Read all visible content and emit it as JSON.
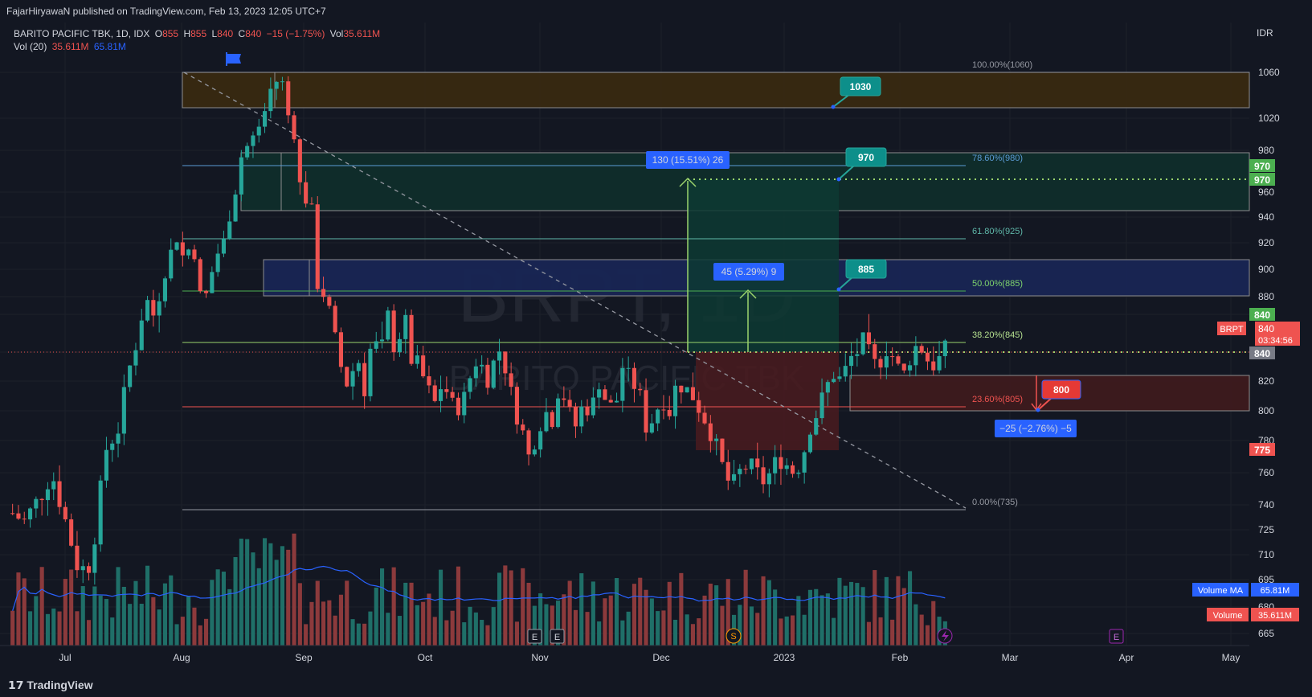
{
  "header": {
    "published": "FajarHiryawaN published on TradingView.com, Feb 13, 2023 12:05 UTC+7"
  },
  "legend": {
    "symbol": "BARITO PACIFIC TBK, 1D, IDX",
    "o_label": "O",
    "o_val": "855",
    "h_label": "H",
    "h_val": "855",
    "l_label": "L",
    "l_val": "840",
    "c_label": "C",
    "c_val": "840",
    "change": "−15 (−1.75%)",
    "vol_label": "Vol",
    "vol_val": "35.611M",
    "vol20_label": "Vol (20)",
    "vol20_a": "35.611M",
    "vol20_b": "65.81M"
  },
  "watermark": {
    "big": "BRPT, 1D",
    "small": "BARITO PACIFIC TBK"
  },
  "currency": "IDR",
  "footer": {
    "brand": "TradingView"
  },
  "colors": {
    "up": "#26a69a",
    "down": "#ef5350",
    "bg": "#131722",
    "grid": "#1e222d",
    "blue": "#2962ff",
    "teal": "#089981"
  },
  "chart_data": {
    "type": "candlestick",
    "x_labels": [
      "Jul",
      "Aug",
      "Sep",
      "Oct",
      "Nov",
      "Dec",
      "2023",
      "Feb",
      "Mar",
      "Apr",
      "May"
    ],
    "y_ticks": [
      1060,
      1020,
      980,
      960,
      940,
      920,
      900,
      880,
      860,
      840,
      820,
      800,
      780,
      760,
      740,
      725,
      710,
      695,
      680,
      665
    ],
    "fib_levels": [
      {
        "label": "100.00%(1060)",
        "value": 1060
      },
      {
        "label": "78.60%(980)",
        "value": 980
      },
      {
        "label": "61.80%(925)",
        "value": 925
      },
      {
        "label": "50.00%(885)",
        "value": 885
      },
      {
        "label": "38.20%(845)",
        "value": 845
      },
      {
        "label": "23.60%(805)",
        "value": 805
      },
      {
        "label": "0.00%(735)",
        "value": 735
      }
    ],
    "targets": [
      "1030",
      "970",
      "885",
      "800"
    ],
    "measure_up_big": "130 (15.51%) 26",
    "measure_up_small": "45 (5.29%) 9",
    "measure_down": "−25 (−2.76%) −5",
    "price_labels": {
      "p970a": "970",
      "p970b": "970",
      "p840a": "840",
      "brpt_tag": "BRPT",
      "brpt_price": "840",
      "countdown": "03:34:56",
      "p840b": "840",
      "p775": "775"
    },
    "vol_tags": {
      "ma_label": "Volume MA",
      "ma_val": "65.81M",
      "vol_label": "Volume",
      "vol_val": "35.611M"
    },
    "last_close": 840,
    "events": [
      "E",
      "E",
      "S",
      "E"
    ]
  }
}
